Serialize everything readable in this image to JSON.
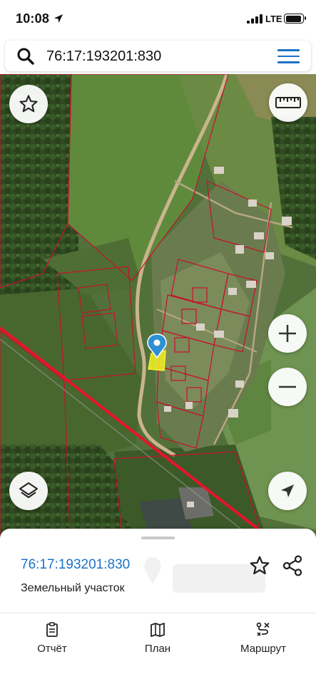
{
  "status_bar": {
    "time": "10:08",
    "network": "LTE"
  },
  "search": {
    "value": "76:17:193201:830"
  },
  "map": {
    "selected_parcel_color": "#f2f226",
    "parcel_border_color": "#c8102e",
    "road_line_color": "#e8132d",
    "marker_color": "#2f8fd3",
    "buttons": [
      "star-icon",
      "ruler-icon",
      "plus-icon",
      "minus-icon",
      "layers-icon",
      "navigation-arrow-icon"
    ]
  },
  "sheet": {
    "parcel_id": "76:17:193201:830",
    "parcel_type": "Земельный участок",
    "tabs": [
      {
        "label": "Отчёт",
        "icon": "report-icon"
      },
      {
        "label": "План",
        "icon": "map-plan-icon"
      },
      {
        "label": "Маршрут",
        "icon": "route-icon"
      }
    ]
  },
  "accent_color": "#1c72c6"
}
